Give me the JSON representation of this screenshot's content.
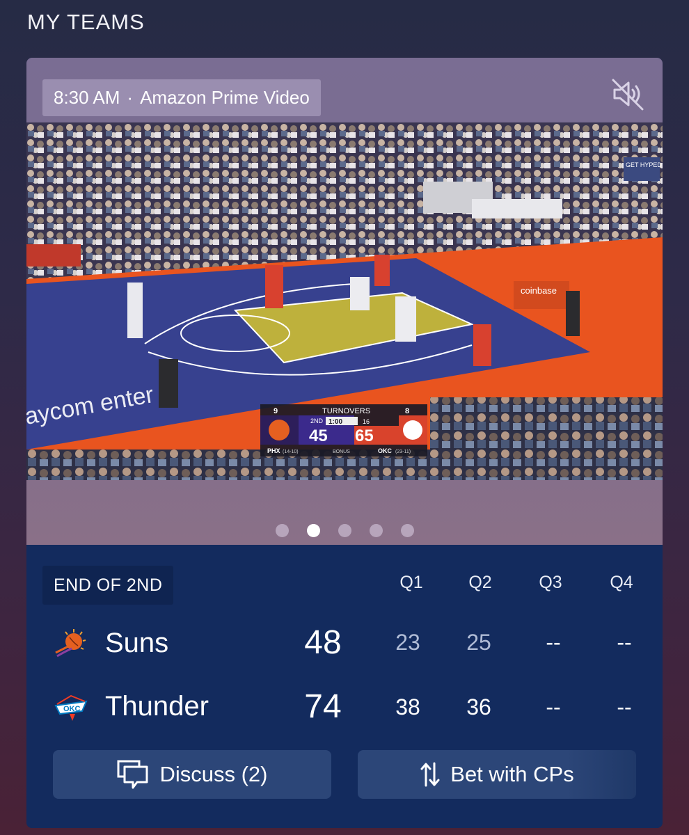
{
  "section": {
    "title": "MY TEAMS"
  },
  "broadcast": {
    "time": "8:30 AM",
    "separator": "·",
    "network": "Amazon Prime Video"
  },
  "video": {
    "scorebug": {
      "home_abbr": "PHX",
      "home_record": "(14-10)",
      "home_score": "45",
      "away_abbr": "OKC",
      "away_record": "(23-11)",
      "away_score": "65",
      "period": "2ND",
      "clock": "1:00",
      "shot_clock": "16",
      "stat_label": "TURNOVERS",
      "home_stat": "9",
      "away_stat": "8",
      "bonus": "BONUS"
    },
    "arena_text": "aycom enter",
    "sponsor": "coinbase",
    "fan_sign": "GET HYPED"
  },
  "pager": {
    "count": 5,
    "active": 1
  },
  "scoreboard": {
    "status": "END OF 2ND",
    "quarters": [
      "Q1",
      "Q2",
      "Q3",
      "Q4"
    ],
    "teams": [
      {
        "name": "Suns",
        "total": "48",
        "q1": "23",
        "q2": "25",
        "q3": "--",
        "q4": "--"
      },
      {
        "name": "Thunder",
        "total": "74",
        "q1": "38",
        "q2": "36",
        "q3": "--",
        "q4": "--"
      }
    ]
  },
  "actions": {
    "discuss_label": "Discuss (2)",
    "bet_label": "Bet with CPs"
  },
  "colors": {
    "scoreboard_bg": "#132b5e",
    "button_bg": "#2c4678",
    "suns_orange": "#e56020",
    "thunder_blue": "#007ac1",
    "thunder_orange": "#ef3b24"
  }
}
